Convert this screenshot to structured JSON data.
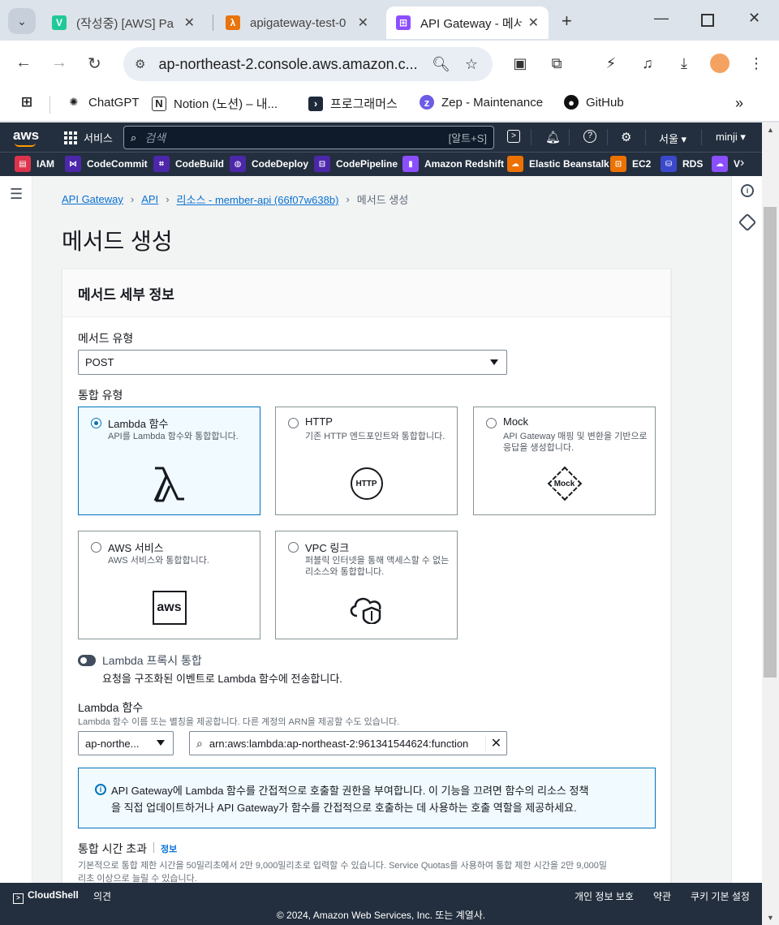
{
  "browser": {
    "tabs": [
      {
        "title": "(작성중) [AWS] Pa",
        "favicon": "V",
        "color": "#20c997"
      },
      {
        "title": "apigateway-test-0",
        "favicon": "λ",
        "color": "#e8740c"
      },
      {
        "title": "API Gateway - 메서",
        "favicon": "⊞",
        "color": "#8c4fff"
      }
    ],
    "url": "ap-northeast-2.console.aws.amazon.c...",
    "bookmarks": [
      {
        "label": "ChatGPT"
      },
      {
        "label": "Notion (노션) – 내..."
      },
      {
        "label": "프로그래머스"
      },
      {
        "label": "Zep - Maintenance"
      },
      {
        "label": "GitHub"
      }
    ]
  },
  "aws_nav": {
    "logo": "aws",
    "services_label": "서비스",
    "search_placeholder": "검색",
    "search_shortcut": "[알트+S]",
    "region": "서울 ▾",
    "user": "minji ▾"
  },
  "favorites": [
    {
      "label": "IAM",
      "color": "#dd344c"
    },
    {
      "label": "CodeCommit",
      "color": "#4d27aa"
    },
    {
      "label": "CodeBuild",
      "color": "#4d27aa"
    },
    {
      "label": "CodeDeploy",
      "color": "#4d27aa"
    },
    {
      "label": "CodePipeline",
      "color": "#4d27aa"
    },
    {
      "label": "Amazon Redshift",
      "color": "#8c4fff"
    },
    {
      "label": "Elastic Beanstalk",
      "color": "#ed7100"
    },
    {
      "label": "EC2",
      "color": "#ed7100"
    },
    {
      "label": "RDS",
      "color": "#3b48cc"
    },
    {
      "label": "V",
      "color": "#8c4fff"
    }
  ],
  "breadcrumb": {
    "items": [
      "API Gateway",
      "API",
      "리소스 - member-api (66f07w638b)"
    ],
    "current": "메서드 생성"
  },
  "page_title": "메서드 생성",
  "panel": {
    "title": "메서드 세부 정보",
    "method_type_label": "메서드 유형",
    "method_type_value": "POST",
    "integration_type_label": "통합 유형",
    "integration_options": [
      {
        "title": "Lambda 함수",
        "desc": "API를 Lambda 함수와 통합합니다.",
        "icon": "lambda-icon",
        "selected": true
      },
      {
        "title": "HTTP",
        "desc": "기존 HTTP 엔드포인트와 통합합니다.",
        "icon": "http-icon",
        "selected": false
      },
      {
        "title": "Mock",
        "desc": "API Gateway 매핑 및 변환을 기반으로 응답을 생성합니다.",
        "icon": "mock-icon",
        "selected": false
      },
      {
        "title": "AWS 서비스",
        "desc": "AWS 서비스와 통합합니다.",
        "icon": "aws-icon",
        "selected": false
      },
      {
        "title": "VPC 링크",
        "desc": "퍼블릭 인터넷을 통해 액세스할 수 없는 리소스와 통합합니다.",
        "icon": "vpc-icon",
        "selected": false
      }
    ],
    "http_icon_text": "HTTP",
    "mock_icon_text": "Mock",
    "aws_icon_text": "aws",
    "proxy_label": "Lambda 프록시 통합",
    "proxy_desc": "요청을 구조화된 이벤트로 Lambda 함수에 전송합니다.",
    "lambda_label": "Lambda 함수",
    "lambda_help": "Lambda 함수 이름 또는 별칭을 제공합니다. 다른 계정의 ARN을 제공할 수도 있습니다.",
    "lambda_region": "ap-northe...",
    "lambda_arn": "arn:aws:lambda:ap-northeast-2:961341544624:function",
    "alert_line1": "API Gateway에 Lambda 함수를 간접적으로 호출할 권한을 부여합니다. 이 기능을 끄려면 함수의 리소스 정책",
    "alert_line2": "을 직접 업데이트하거나 API Gateway가 함수를 간접적으로 호출하는 데 사용하는 호출 역할을 제공하세요.",
    "timeout_label": "통합 시간 초과",
    "timeout_info": "정보",
    "timeout_help1": "기본적으로 통합 제한 시간을 50밀리초에서 2만 9,000밀리초로 입력할 수 있습니다. Service Quotas를 사용하여 통합 제한 시간을 2만 9,000밀",
    "timeout_help2": "리초 이상으로 늘릴 수 있습니다."
  },
  "footer": {
    "cloudshell": "CloudShell",
    "feedback": "의견",
    "privacy": "개인 정보 보호",
    "terms": "약관",
    "cookies": "쿠키 기본 설정",
    "copyright": "© 2024, Amazon Web Services, Inc. 또는 계열사."
  }
}
